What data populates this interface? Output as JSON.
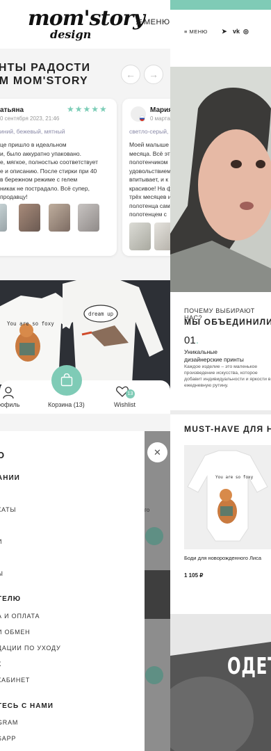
{
  "brand": {
    "logo": "mom'story",
    "logo_sub": "design"
  },
  "header": {
    "menu_label": "МЕНЮ"
  },
  "reviews": {
    "title_line1": "ЕНТЫ РАДОСТИ",
    "title_line2": "AM MOM'STORY",
    "prev_icon": "arrow-left-icon",
    "next_icon": "arrow-right-icon",
    "cards": [
      {
        "name": "атьяна",
        "date": "0 сентября 2023, 21:46",
        "stars": "★★★★★",
        "color": "иний, бежевый, мятный",
        "lines": [
          "це пришло в идеальном",
          "и, было аккуратно упаковано.",
          "е, мягкое, полностью соответствует",
          "е и описанию. После стирки при 40",
          "в бережном режиме с гелем",
          "никак не пострадало. Всё супер,",
          "продавцу!"
        ]
      },
      {
        "name": "Мария",
        "date": "0 марта",
        "color": "светло-серый,",
        "lines": [
          "Моей малыше",
          "месяца. Всё эт",
          "полотенчиком",
          "удовольствием",
          "впитывает, и к",
          "красивое! На ф",
          "трёх месяцев и",
          "полотенца сам",
          "полотенцем с"
        ]
      }
    ]
  },
  "bottom_nav": {
    "profile_label": "рофиль",
    "cart_label": "Корзина (13)",
    "wishlist_label": "Wishlist",
    "wishlist_count": "13"
  },
  "drawer": {
    "top": "О",
    "sections": [
      {
        "heading": "АНИИ",
        "items": [
          "КАТЫ",
          "И",
          "Ы"
        ]
      },
      {
        "heading": "ТЕЛЮ",
        "items": [
          "А И ОПЛАТА",
          "И ОБМЕН",
          "ДАЦИИ ПО УХОДУ",
          "К",
          "КАБИНЕТ"
        ]
      },
      {
        "heading": "ТЕСЬ С НАМИ",
        "items": [
          "GRAM",
          "SAPP"
        ]
      }
    ],
    "dimmed_text": "го"
  },
  "right": {
    "menu_label": "МЕНЮ",
    "social": [
      "telegram-icon",
      "vk-icon",
      "instagram-icon"
    ],
    "social_glyphs": [
      "➤",
      "vk",
      "◎"
    ],
    "why_label": "ПОЧЕМУ ВЫБИРАЮТ НАС?",
    "unite_heading": "МЫ ОБЪЕДИНИЛИ",
    "feature": {
      "number": "01",
      "title_line1": "Уникальные",
      "title_line2": "дизайнерские принты",
      "text": "Каждое изделие – это маленькое произведение искусства, которое добавит индивидуальности и яркости в ежедневную рутину."
    },
    "musthave_heading": "MUST-HAVE ДЛЯ НО",
    "product": {
      "name": "Боди для новорожденного Лиса",
      "price": "1 105 ₽"
    },
    "banner_text": "ОДЕТ"
  },
  "prints": {
    "fox_text": "You are so foxy",
    "bird_text": "dream up"
  },
  "colors": {
    "accent": "#7fcbb6",
    "stars": "#7ccdb7"
  }
}
